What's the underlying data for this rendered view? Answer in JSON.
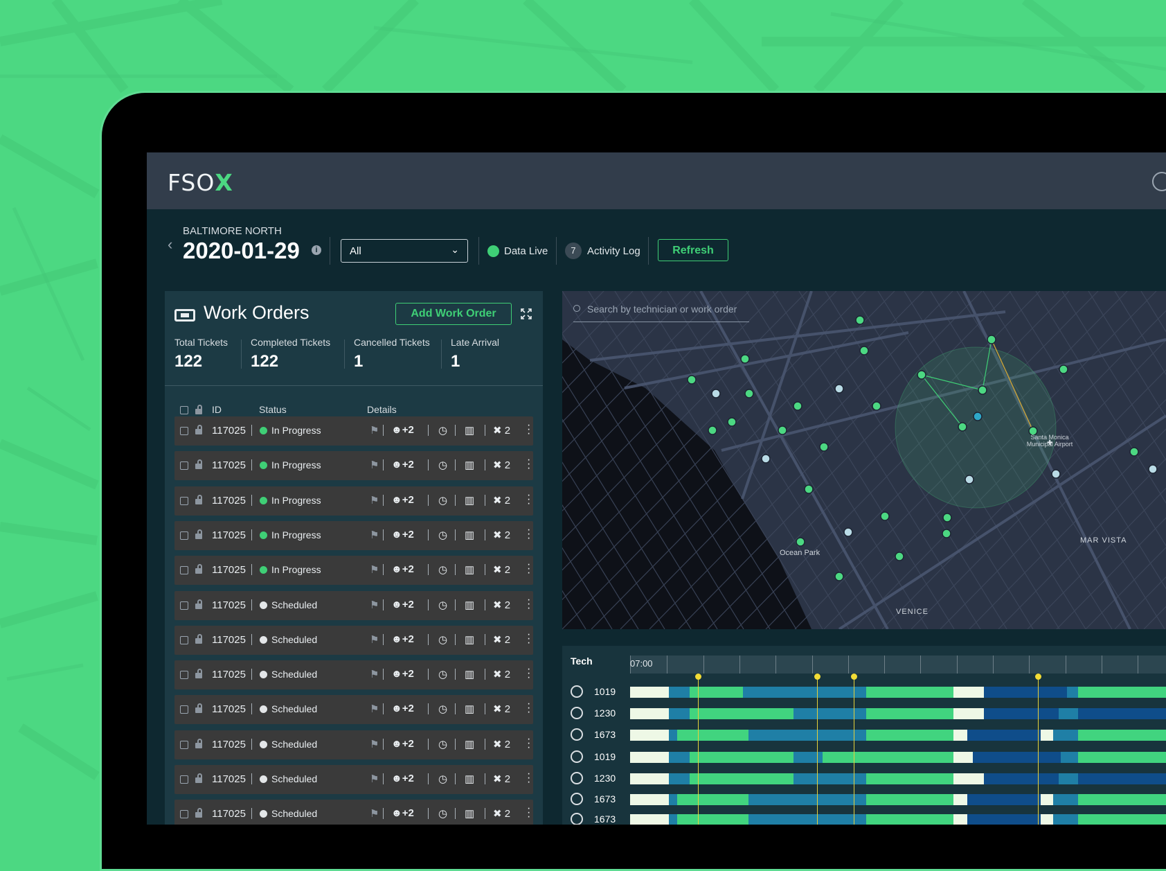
{
  "app": {
    "logo_text": "FSO",
    "logo_accent": "X"
  },
  "header": {
    "region": "BALTIMORE NORTH",
    "date": "2020-01-29",
    "filter_value": "All",
    "live_label": "Data Live",
    "activity_count": "7",
    "activity_label": "Activity Log",
    "refresh_label": "Refresh"
  },
  "work_orders": {
    "title": "Work Orders",
    "add_label": "Add Work Order",
    "stats": [
      {
        "label": "Total Tickets",
        "value": "122"
      },
      {
        "label": "Completed Tickets",
        "value": "122"
      },
      {
        "label": "Cancelled Tickets",
        "value": "1"
      },
      {
        "label": "Late Arrival",
        "value": "1"
      }
    ],
    "columns": {
      "id": "ID",
      "status": "Status",
      "details": "Details"
    },
    "rows": [
      {
        "id": "117025",
        "status": "In Progress",
        "assignees": "+2",
        "tools": "2"
      },
      {
        "id": "117025",
        "status": "In Progress",
        "assignees": "+2",
        "tools": "2"
      },
      {
        "id": "117025",
        "status": "In Progress",
        "assignees": "+2",
        "tools": "2"
      },
      {
        "id": "117025",
        "status": "In Progress",
        "assignees": "+2",
        "tools": "2"
      },
      {
        "id": "117025",
        "status": "In Progress",
        "assignees": "+2",
        "tools": "2"
      },
      {
        "id": "117025",
        "status": "Scheduled",
        "assignees": "+2",
        "tools": "2"
      },
      {
        "id": "117025",
        "status": "Scheduled",
        "assignees": "+2",
        "tools": "2"
      },
      {
        "id": "117025",
        "status": "Scheduled",
        "assignees": "+2",
        "tools": "2"
      },
      {
        "id": "117025",
        "status": "Scheduled",
        "assignees": "+2",
        "tools": "2"
      },
      {
        "id": "117025",
        "status": "Scheduled",
        "assignees": "+2",
        "tools": "2"
      },
      {
        "id": "117025",
        "status": "Scheduled",
        "assignees": "+2",
        "tools": "2"
      },
      {
        "id": "117025",
        "status": "Scheduled",
        "assignees": "+2",
        "tools": "2"
      }
    ]
  },
  "map": {
    "search_placeholder": "Search by technician or work order",
    "labels": {
      "ocean_park": "Ocean Park",
      "venice": "VENICE",
      "mar_vista": "MAR VISTA",
      "airport_1": "Santa Monica",
      "airport_2": "Municipal Airport"
    }
  },
  "timeline": {
    "tech_header": "Tech",
    "start_time": "07:00",
    "techs": [
      "1019",
      "1230",
      "1673",
      "1019",
      "1230",
      "1673",
      "1673"
    ]
  },
  "colors": {
    "brand": "#4cd882",
    "in_progress": "#3fcf76",
    "scheduled": "#e3e6e8",
    "timeline_green": "#41d47f",
    "timeline_teal": "#1f7fa6",
    "timeline_navy": "#0f4d8a",
    "timeline_cream": "#eef8e6",
    "marker_yellow": "#f2dc36"
  }
}
